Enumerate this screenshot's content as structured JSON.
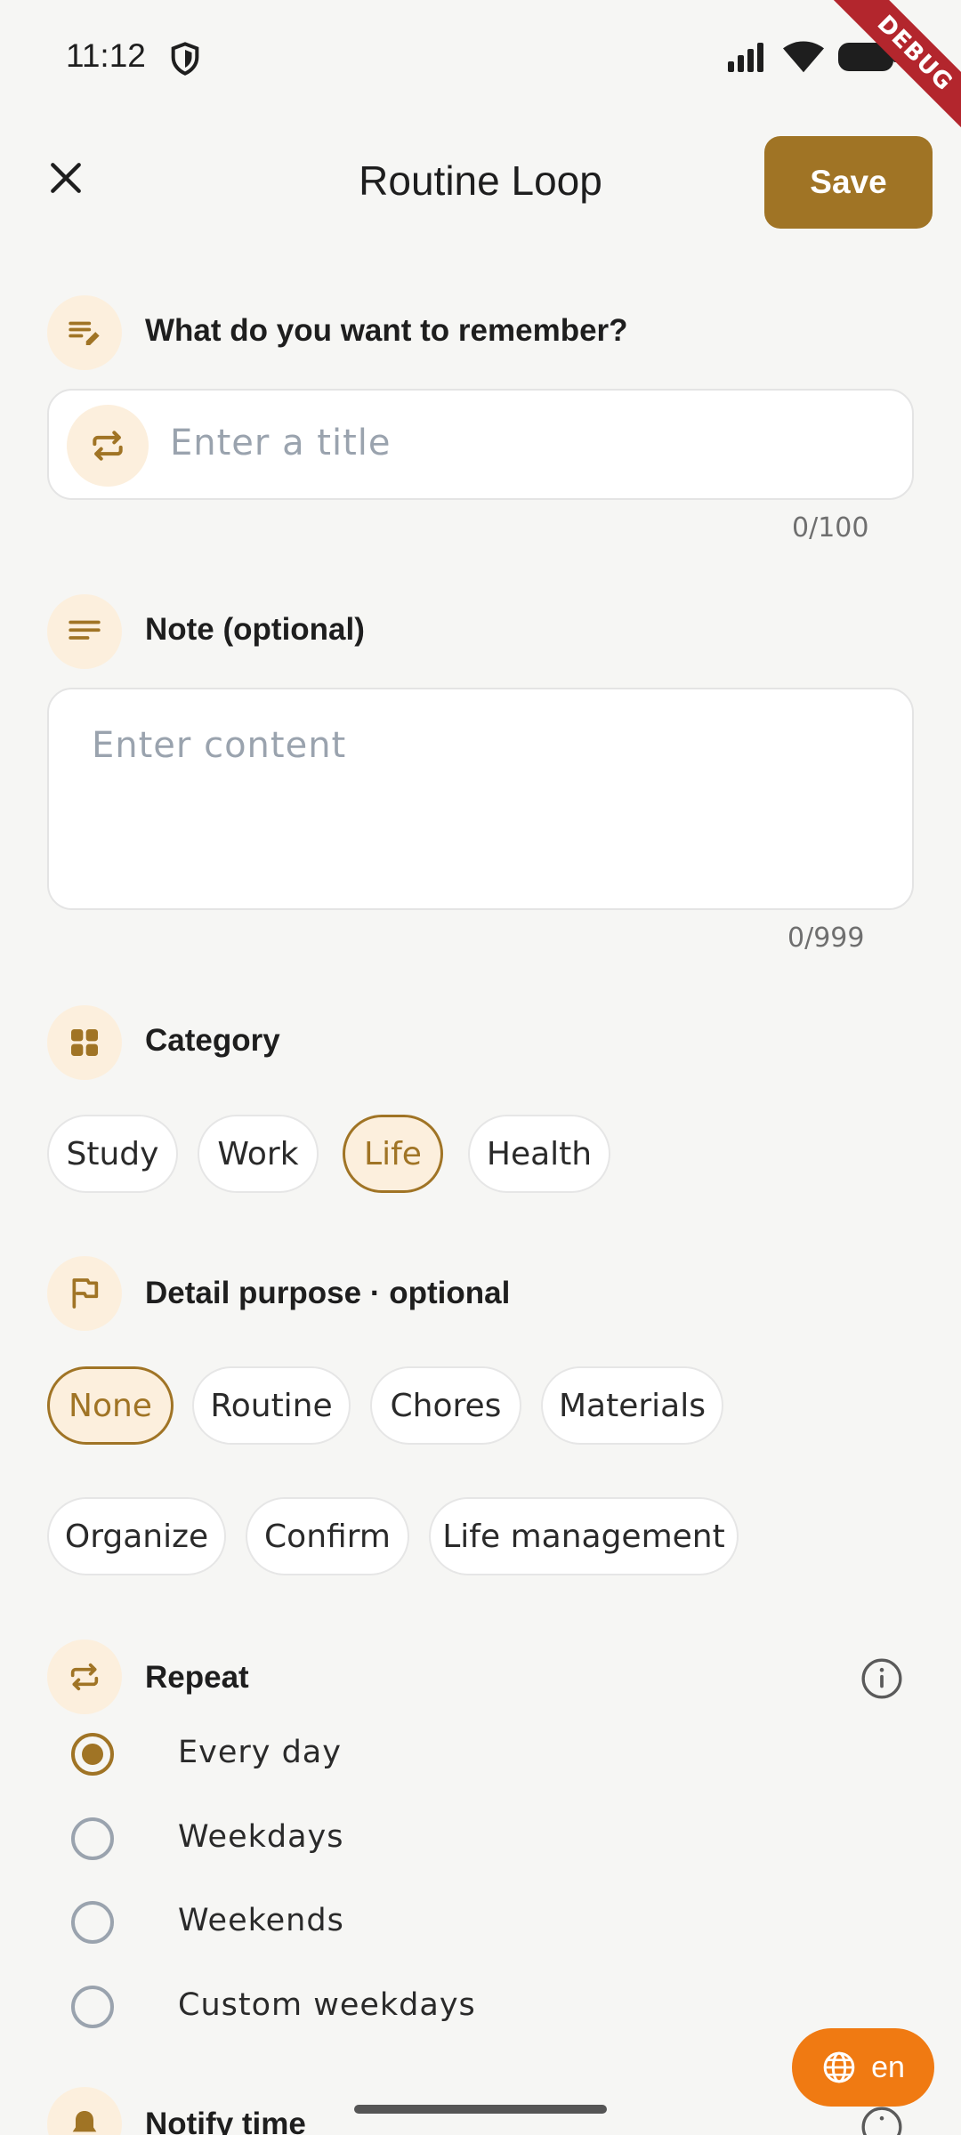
{
  "status_bar": {
    "time": "11:12"
  },
  "debug_banner": "DEBUG",
  "header": {
    "title": "Routine Loop",
    "save_label": "Save"
  },
  "title_section": {
    "label": "What do you want to remember?",
    "placeholder": "Enter a title",
    "counter": "0/100"
  },
  "note_section": {
    "label": "Note (optional)",
    "placeholder": "Enter content",
    "counter": "0/999"
  },
  "category_section": {
    "label": "Category",
    "chips": [
      {
        "label": "Study",
        "selected": false
      },
      {
        "label": "Work",
        "selected": false
      },
      {
        "label": "Life",
        "selected": true
      },
      {
        "label": "Health",
        "selected": false
      }
    ]
  },
  "purpose_section": {
    "label": "Detail purpose · optional",
    "chips": [
      {
        "label": "None",
        "selected": true
      },
      {
        "label": "Routine",
        "selected": false
      },
      {
        "label": "Chores",
        "selected": false
      },
      {
        "label": "Materials",
        "selected": false
      },
      {
        "label": "Organize",
        "selected": false
      },
      {
        "label": "Confirm",
        "selected": false
      },
      {
        "label": "Life management",
        "selected": false
      }
    ]
  },
  "repeat_section": {
    "label": "Repeat",
    "options": [
      {
        "label": "Every day",
        "selected": true
      },
      {
        "label": "Weekdays",
        "selected": false
      },
      {
        "label": "Weekends",
        "selected": false
      },
      {
        "label": "Custom weekdays",
        "selected": false
      }
    ]
  },
  "notify_section": {
    "label": "Notify time"
  },
  "lang_fab": {
    "label": "en"
  },
  "colors": {
    "accent": "#A07425",
    "accent_light": "#FCEFDD",
    "fab": "#F07A12",
    "background": "#F6F6F4"
  }
}
